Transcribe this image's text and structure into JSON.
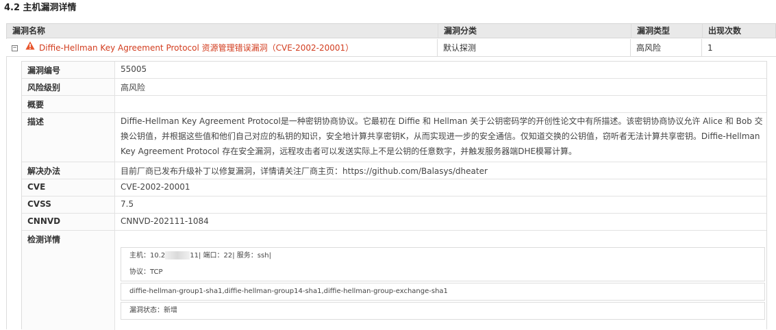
{
  "section_title": "4.2 主机漏洞详情",
  "table": {
    "headers": [
      "漏洞名称",
      "漏洞分类",
      "漏洞类型",
      "出现次数"
    ],
    "row": {
      "toggle": "−",
      "icon": "warning-triangle-icon",
      "name": "Diffie-Hellman Key Agreement Protocol 资源管理错误漏洞（CVE-2002-20001）",
      "category": "默认探测",
      "type": "高风险",
      "count": "1"
    }
  },
  "details": [
    {
      "label": "漏洞编号",
      "value": "55005"
    },
    {
      "label": "风险级别",
      "value": "高风险"
    },
    {
      "label": "概要",
      "value": ""
    },
    {
      "label": "描述",
      "value": "Diffie-Hellman Key Agreement Protocol是一种密钥协商协议。它最初在 Diffie 和 Hellman 关于公钥密码学的开创性论文中有所描述。该密钥协商协议允许 Alice 和 Bob 交换公钥值，并根据这些值和他们自己对应的私钥的知识，安全地计算共享密钥K，从而实现进一步的安全通信。仅知道交换的公钥值，窃听者无法计算共享密钥。Diffie-Hellman Key Agreement Protocol 存在安全漏洞，远程攻击者可以发送实际上不是公钥的任意数字，并触发服务器端DHE模幂计算。"
    },
    {
      "label": "解决办法",
      "value": "目前厂商已发布升级补丁以修复漏洞，详情请关注厂商主页：https://github.com/Balasys/dheater"
    },
    {
      "label": "CVE",
      "value": "CVE-2002-20001"
    },
    {
      "label": "CVSS",
      "value": "7.5"
    },
    {
      "label": "CNNVD",
      "value": "CNNVD-202111-1084"
    },
    {
      "label": "检测详情",
      "value": ""
    }
  ],
  "detection": {
    "host_prefix": "主机：10.2",
    "host_suffix": "11| 端口：22| 服务：ssh|",
    "protocol": "协议：TCP",
    "algorithms": "diffie-hellman-group1-sha1,diffie-hellman-group14-sha1,diffie-hellman-group-exchange-sha1",
    "status": "漏洞状态：新增"
  },
  "colors": {
    "link": "#d23c1e",
    "warning": "#e8552d",
    "header_bg": "#e9e9e9"
  }
}
